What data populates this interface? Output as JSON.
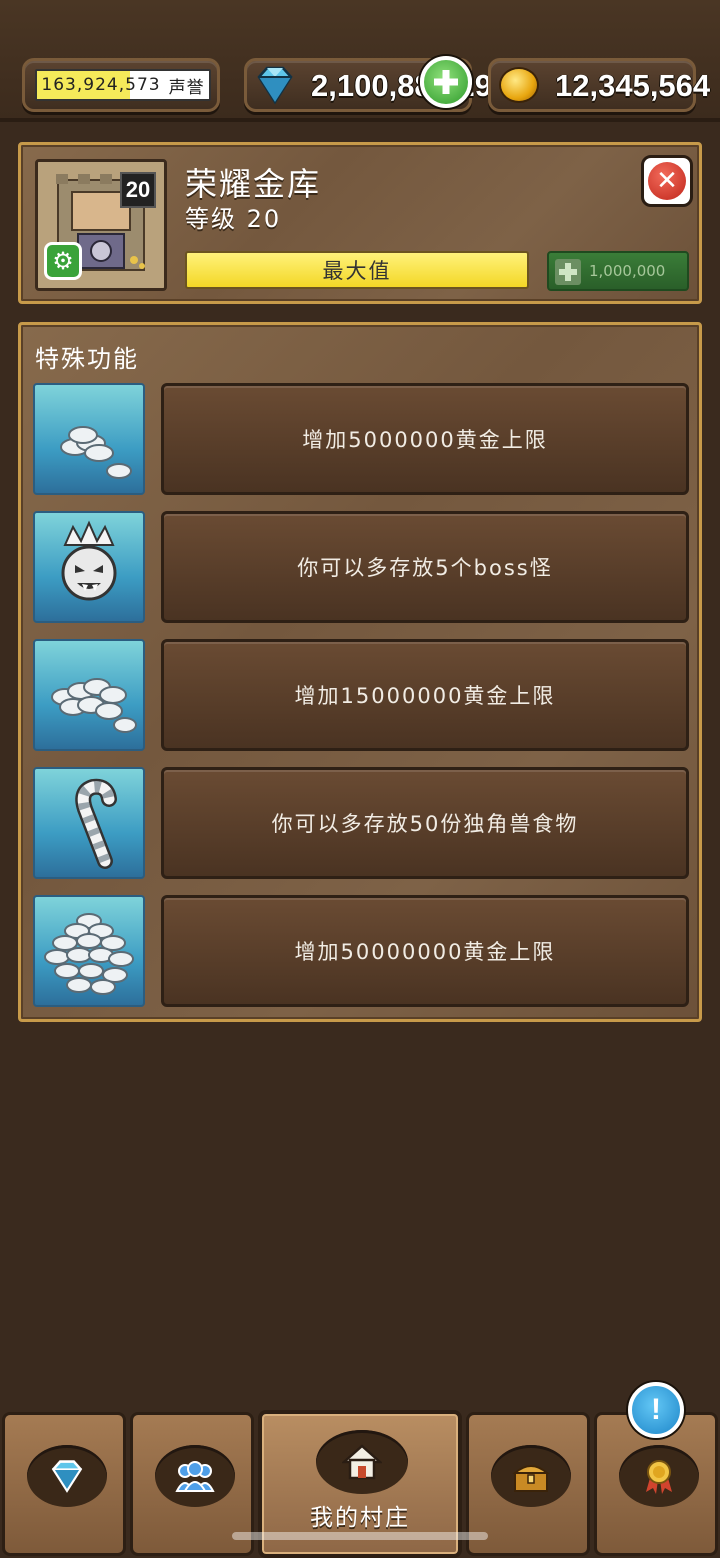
{
  "topbar": {
    "reputation": {
      "value": "163,924,573",
      "unit": "声誉",
      "fill_percent": 54
    },
    "gems": {
      "amount": "2,100,881,297",
      "icon": "diamond-icon"
    },
    "gold": {
      "amount": "12,345,564",
      "icon": "gold-coin-icon"
    }
  },
  "building": {
    "name": "荣耀金库",
    "level_text": "等级 20",
    "level_badge": "20",
    "max_label": "最大值",
    "upgrade_cost": "1,000,000"
  },
  "features": {
    "title": "特殊功能",
    "items": [
      {
        "icon": "silver-coins-small-icon",
        "text": "增加5000000黄金上限"
      },
      {
        "icon": "boss-monster-crown-icon",
        "text": "你可以多存放5个boss怪"
      },
      {
        "icon": "silver-coins-medium-icon",
        "text": "增加15000000黄金上限"
      },
      {
        "icon": "candy-cane-icon",
        "text": "你可以多存放50份独角兽食物"
      },
      {
        "icon": "silver-coins-large-icon",
        "text": "增加50000000黄金上限"
      }
    ]
  },
  "nav": {
    "tabs": [
      {
        "icon": "gem-shop-icon"
      },
      {
        "icon": "friends-icon"
      },
      {
        "icon": "home-icon",
        "label": "我的村庄"
      },
      {
        "icon": "treasure-chest-icon"
      },
      {
        "icon": "achievement-medal-icon"
      }
    ],
    "alert_symbol": "!"
  },
  "colors": {
    "accent_yellow": "#f3d726",
    "panel_border": "#c79a4a",
    "upgrade_green": "#2a5f29",
    "close_red": "#c0261b"
  }
}
